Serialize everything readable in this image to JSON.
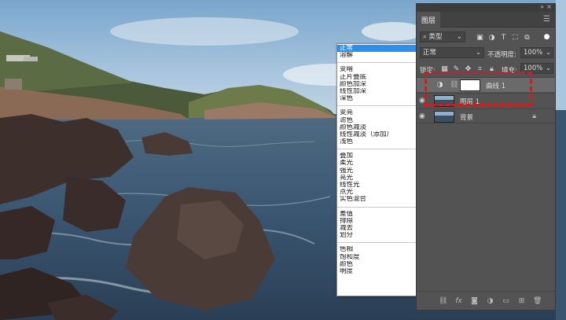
{
  "blend_menu": {
    "groups": [
      [
        "正常",
        "溶解"
      ],
      [
        "变暗",
        "正片叠底",
        "颜色加深",
        "线性加深",
        "深色"
      ],
      [
        "变亮",
        "滤色",
        "颜色减淡",
        "线性减淡（添加）",
        "浅色"
      ],
      [
        "叠加",
        "柔光",
        "强光",
        "亮光",
        "线性光",
        "点光",
        "实色混合"
      ],
      [
        "差值",
        "排除",
        "减去",
        "划分"
      ],
      [
        "色相",
        "饱和度",
        "颜色",
        "明度"
      ]
    ],
    "selected": "正常"
  },
  "panel": {
    "tab": "图层",
    "filter_kind": "类型",
    "blend_mode": "正常",
    "opacity_label": "不透明度:",
    "opacity_value": "100%",
    "lock_label": "锁定:",
    "fill_label": "填充:",
    "fill_value": "100%",
    "layers": [
      {
        "name": "曲线 1"
      },
      {
        "name": "图层 1"
      },
      {
        "name": "背景"
      }
    ]
  },
  "colors": {
    "panel": "#535353",
    "selection": "#2f8ee9",
    "annotation": "#e0141a"
  },
  "icons": {
    "panel_menu": "hamburger-icon",
    "visibility": "eye-icon",
    "lock": "lock-icon",
    "adjustment": "adjustment-layer-icon"
  }
}
